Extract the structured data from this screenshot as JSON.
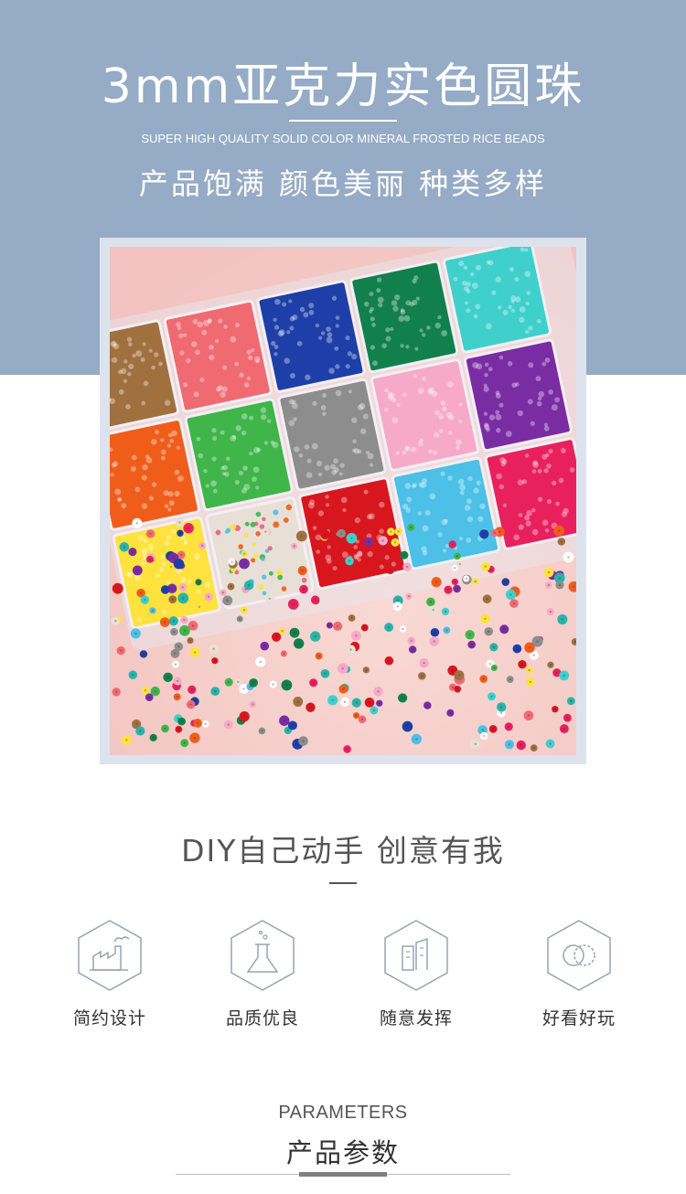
{
  "header": {
    "title": "3mm亚克力实色圆珠",
    "subtitle_en": "SUPER HIGH QUALITY SOLID COLOR MINERAL FROSTED RICE BEADS",
    "tagline": "产品饱满 颜色美丽 种类多样",
    "background_color": "#95abc6"
  },
  "photo": {
    "description_icon": "bead-organizer-photo",
    "compartment_colors": [
      "#a0703f",
      "#f06a72",
      "#1e3fa8",
      "#11804c",
      "#3fd0cc",
      "#f05d1a",
      "#3fb54a",
      "#8d8d8d",
      "#f7a9c8",
      "#7a2ca3",
      "#ffe23d",
      "#e8e0d6",
      "#d8161e",
      "#4cc0e6",
      "#e8205e"
    ]
  },
  "diy": {
    "heading": "DIY自己动手 创意有我"
  },
  "features": [
    {
      "label": "简约设计",
      "icon": "factory-icon"
    },
    {
      "label": "品质优良",
      "icon": "flask-icon"
    },
    {
      "label": "随意发挥",
      "icon": "buildings-icon"
    },
    {
      "label": "好看好玩",
      "icon": "rings-icon"
    }
  ],
  "parameters": {
    "heading_en": "PARAMETERS",
    "heading_zh": "产品参数"
  }
}
